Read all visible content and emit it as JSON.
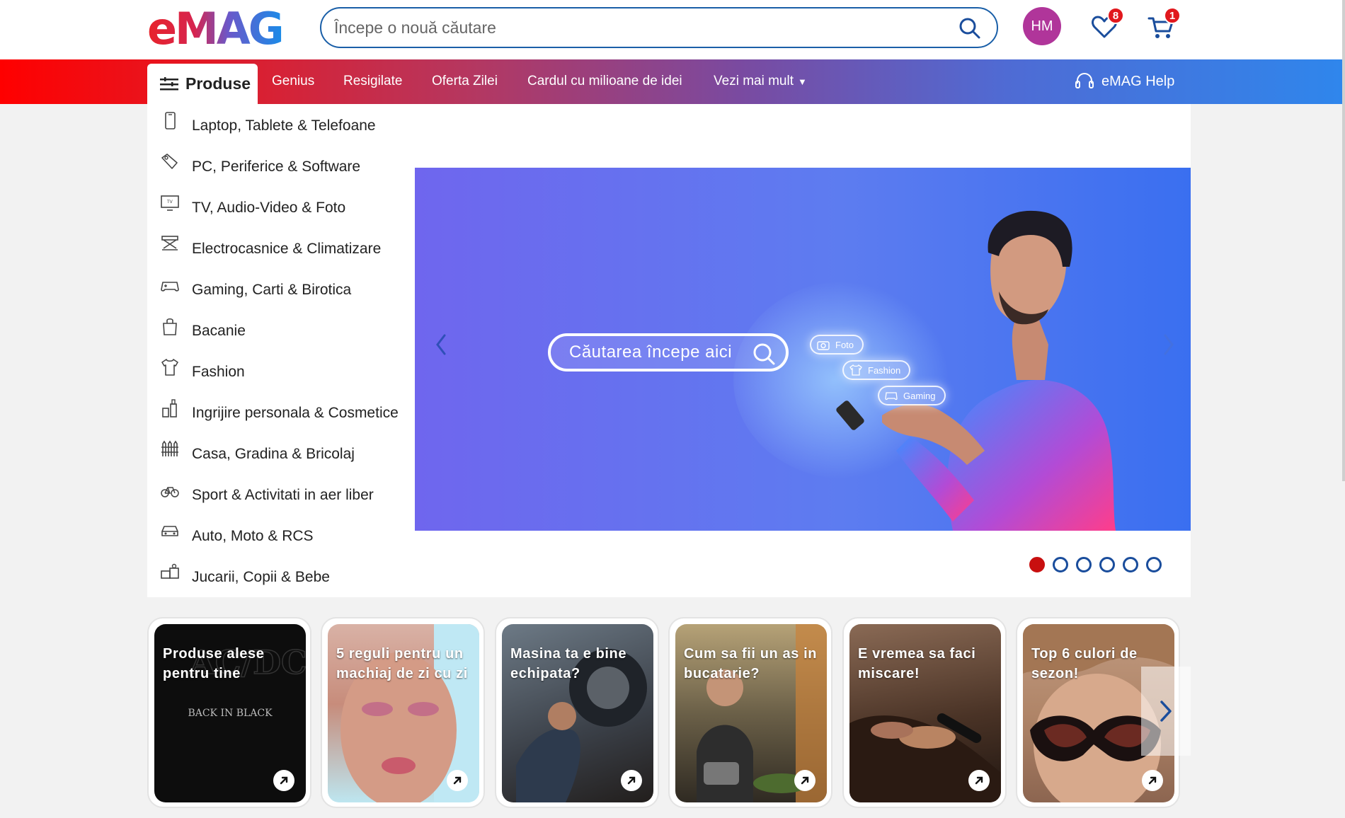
{
  "header": {
    "logo_text": "eMAG",
    "search_placeholder": "Începe o nouă căutare",
    "avatar_initials": "HM",
    "favorites_count": "8",
    "cart_count": "1"
  },
  "nav": {
    "produse_label": "Produse",
    "items": [
      "Genius",
      "Resigilate",
      "Oferta Zilei",
      "Cardul cu milioane de idei",
      "Vezi mai mult"
    ],
    "help_label": "eMAG Help"
  },
  "sidebar": {
    "categories": [
      {
        "label": "Laptop, Tablete & Telefoane",
        "icon": "phone-icon"
      },
      {
        "label": "PC, Periferice & Software",
        "icon": "tag-icon"
      },
      {
        "label": "TV, Audio-Video & Foto",
        "icon": "tv-icon"
      },
      {
        "label": "Electrocasnice & Climatizare",
        "icon": "appliance-icon"
      },
      {
        "label": "Gaming, Carti & Birotica",
        "icon": "gamepad-icon"
      },
      {
        "label": "Bacanie",
        "icon": "grocery-bag-icon"
      },
      {
        "label": "Fashion",
        "icon": "tshirt-icon"
      },
      {
        "label": "Ingrijire personala & Cosmetice",
        "icon": "cosmetics-icon"
      },
      {
        "label": "Casa, Gradina & Bricolaj",
        "icon": "fence-icon"
      },
      {
        "label": "Sport & Activitati in aer liber",
        "icon": "bicycle-icon"
      },
      {
        "label": "Auto, Moto & RCS",
        "icon": "car-icon"
      },
      {
        "label": "Jucarii, Copii & Bebe",
        "icon": "toys-icon"
      }
    ]
  },
  "hero": {
    "search_pill": "Căutarea începe aici",
    "chips": [
      "Foto",
      "Fashion",
      "Gaming"
    ],
    "slides_total": 6,
    "active_slide": 1
  },
  "cards": [
    {
      "title": "Produse alese pentru tine",
      "subtitle": "BACK IN BLACK"
    },
    {
      "title": "5 reguli pentru un machiaj de zi cu zi"
    },
    {
      "title": "Masina ta e bine echipata?"
    },
    {
      "title": "Cum sa fii un as in bucatarie?"
    },
    {
      "title": "E vremea sa faci miscare!"
    },
    {
      "title": "Top 6 culori de sezon!"
    }
  ],
  "colors": {
    "brand_red": "#e1181d",
    "brand_blue": "#1a5fa8",
    "hero_bg": "#6f6cf0"
  }
}
